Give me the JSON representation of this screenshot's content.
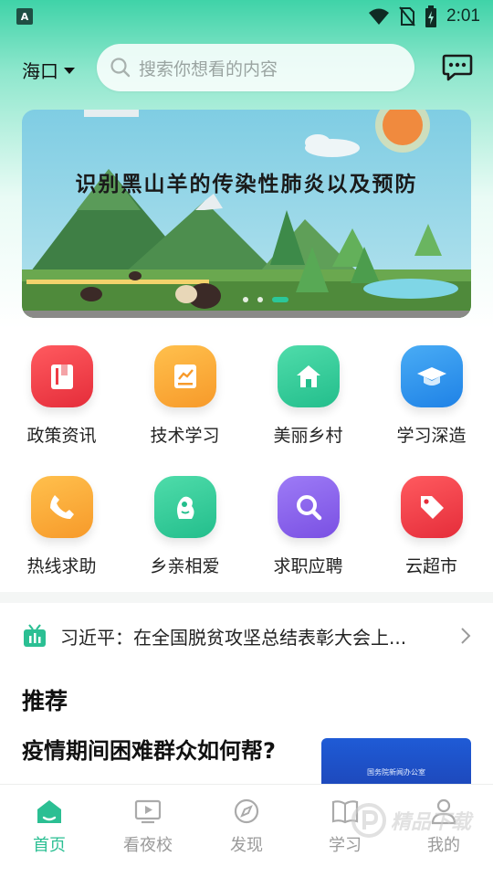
{
  "status_bar": {
    "time": "2:01",
    "app_letter": "A"
  },
  "header": {
    "city": "海口",
    "search_placeholder": "搜索你想看的内容"
  },
  "banner": {
    "title": "识别黑山羊的传染性肺炎以及预防"
  },
  "grid": [
    {
      "label": "政策资讯",
      "icon": "book-icon",
      "color": "#ee3b45"
    },
    {
      "label": "技术学习",
      "icon": "chart-book-icon",
      "color": "#fba63b"
    },
    {
      "label": "美丽乡村",
      "icon": "home-icon",
      "color": "#33cc9a"
    },
    {
      "label": "学习深造",
      "icon": "graduation-cap-icon",
      "color": "#3196ee"
    },
    {
      "label": "热线求助",
      "icon": "phone-icon",
      "color": "#fba63b"
    },
    {
      "label": "乡亲相爱",
      "icon": "people-icon",
      "color": "#33cc9a"
    },
    {
      "label": "求职应聘",
      "icon": "search-icon",
      "color": "#8a63ec"
    },
    {
      "label": "云超市",
      "icon": "tag-icon",
      "color": "#ee3b45"
    }
  ],
  "news_ticker": {
    "text": "习近平：在全国脱贫攻坚总结表彰大会上..."
  },
  "recommend": {
    "title": "推荐",
    "article_title": "疫情期间困难群众如何帮?",
    "thumb_text": "国务院新闻办公室"
  },
  "tabs": [
    {
      "label": "首页",
      "active": true
    },
    {
      "label": "看夜校",
      "active": false
    },
    {
      "label": "发现",
      "active": false
    },
    {
      "label": "学习",
      "active": false
    },
    {
      "label": "我的",
      "active": false
    }
  ],
  "watermark": {
    "text": "精品下载"
  },
  "colors": {
    "accent": "#2bbf93"
  }
}
